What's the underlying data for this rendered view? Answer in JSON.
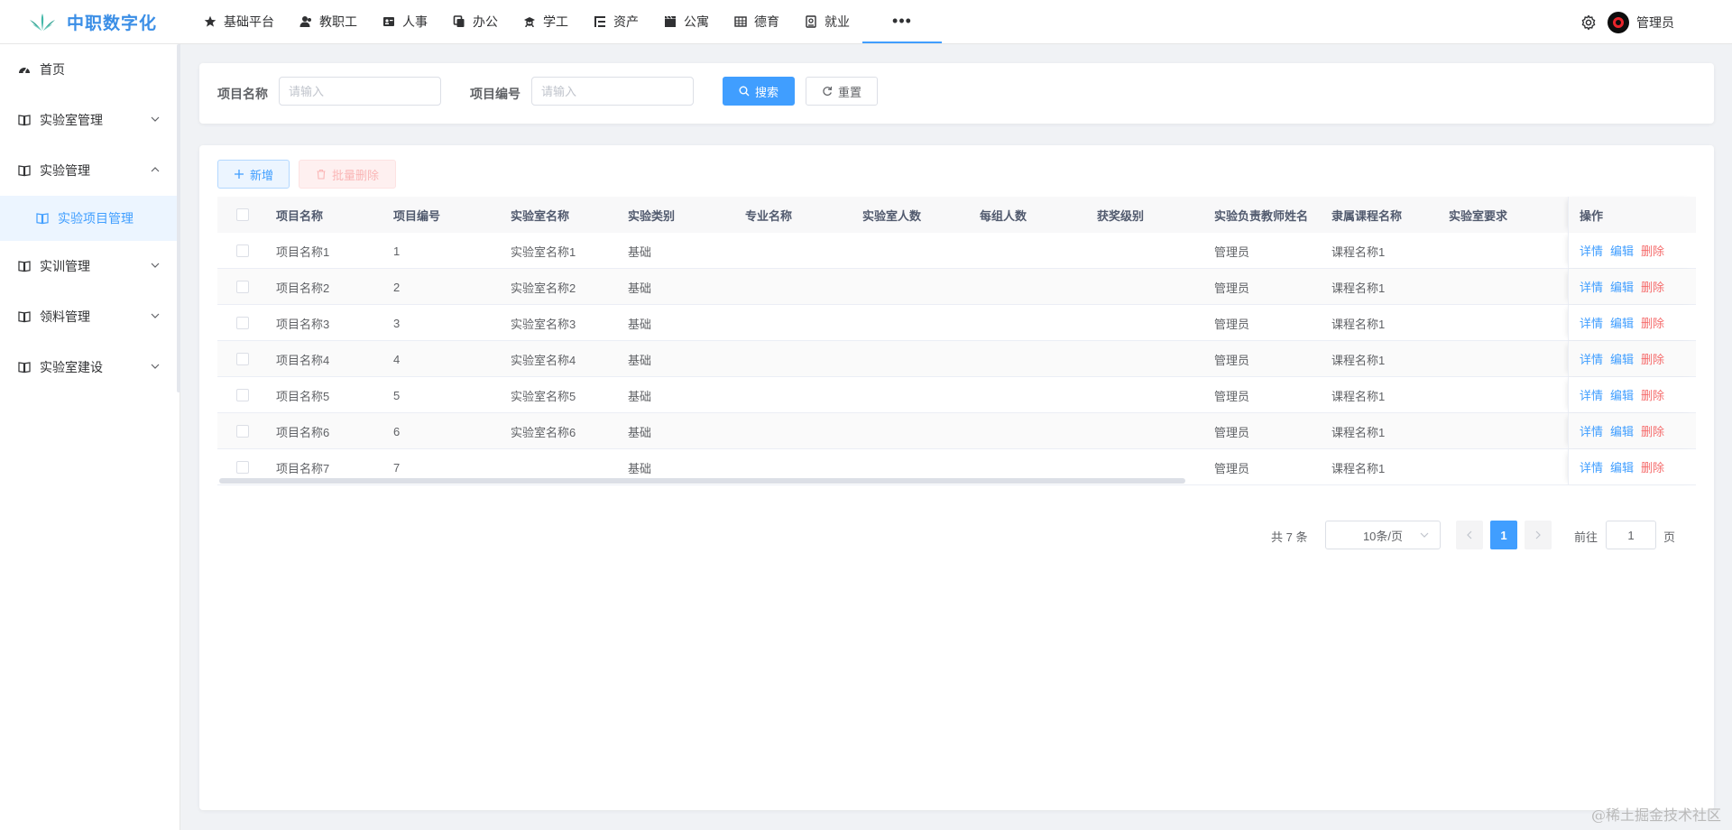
{
  "app": {
    "title": "中职数字化"
  },
  "topnav": {
    "items": [
      {
        "label": "基础平台",
        "icon": "star-icon"
      },
      {
        "label": "教职工",
        "icon": "users-icon"
      },
      {
        "label": "人事",
        "icon": "id-card-icon"
      },
      {
        "label": "办公",
        "icon": "copy-icon"
      },
      {
        "label": "学工",
        "icon": "student-icon"
      },
      {
        "label": "资产",
        "icon": "tree-list-icon"
      },
      {
        "label": "公寓",
        "icon": "clapper-icon"
      },
      {
        "label": "德育",
        "icon": "grid-icon"
      },
      {
        "label": "就业",
        "icon": "briefcase-icon"
      }
    ],
    "more": "•••"
  },
  "user": {
    "name": "管理员"
  },
  "sidebar": {
    "items": [
      {
        "label": "首页"
      },
      {
        "label": "实验室管理"
      },
      {
        "label": "实验管理"
      },
      {
        "label": "实训管理"
      },
      {
        "label": "领料管理"
      },
      {
        "label": "实验室建设"
      }
    ],
    "active_sub": "实验项目管理"
  },
  "search": {
    "name_label": "项目名称",
    "name_placeholder": "请输入",
    "code_label": "项目编号",
    "code_placeholder": "请输入",
    "search_label": "搜索",
    "reset_label": "重置"
  },
  "toolbar": {
    "add_label": "新增",
    "batch_delete_label": "批量删除"
  },
  "table": {
    "columns": [
      "项目名称",
      "项目编号",
      "实验室名称",
      "实验类别",
      "专业名称",
      "实验室人数",
      "每组人数",
      "获奖级别",
      "实验负责教师姓名",
      "隶属课程名称",
      "实验室要求"
    ],
    "ops_header": "操作",
    "ops": {
      "detail": "详情",
      "edit": "编辑",
      "delete": "删除"
    },
    "rows": [
      [
        "项目名称1",
        "1",
        "实验室名称1",
        "基础",
        "",
        "",
        "",
        "",
        "管理员",
        "课程名称1",
        ""
      ],
      [
        "项目名称2",
        "2",
        "实验室名称2",
        "基础",
        "",
        "",
        "",
        "",
        "管理员",
        "课程名称1",
        ""
      ],
      [
        "项目名称3",
        "3",
        "实验室名称3",
        "基础",
        "",
        "",
        "",
        "",
        "管理员",
        "课程名称1",
        ""
      ],
      [
        "项目名称4",
        "4",
        "实验室名称4",
        "基础",
        "",
        "",
        "",
        "",
        "管理员",
        "课程名称1",
        ""
      ],
      [
        "项目名称5",
        "5",
        "实验室名称5",
        "基础",
        "",
        "",
        "",
        "",
        "管理员",
        "课程名称1",
        ""
      ],
      [
        "项目名称6",
        "6",
        "实验室名称6",
        "基础",
        "",
        "",
        "",
        "",
        "管理员",
        "课程名称1",
        ""
      ],
      [
        "项目名称7",
        "7",
        "",
        "基础",
        "",
        "",
        "",
        "",
        "管理员",
        "课程名称1",
        ""
      ]
    ]
  },
  "pagination": {
    "total_text": "共 7 条",
    "page_size": "10条/页",
    "current_page": "1",
    "goto_label": "前往",
    "goto_value": "1",
    "page_unit": "页"
  },
  "watermark": "@稀土掘金技术社区",
  "colors": {
    "primary": "#409eff",
    "danger": "#f56c6c",
    "brand": "#3a8ee6"
  }
}
